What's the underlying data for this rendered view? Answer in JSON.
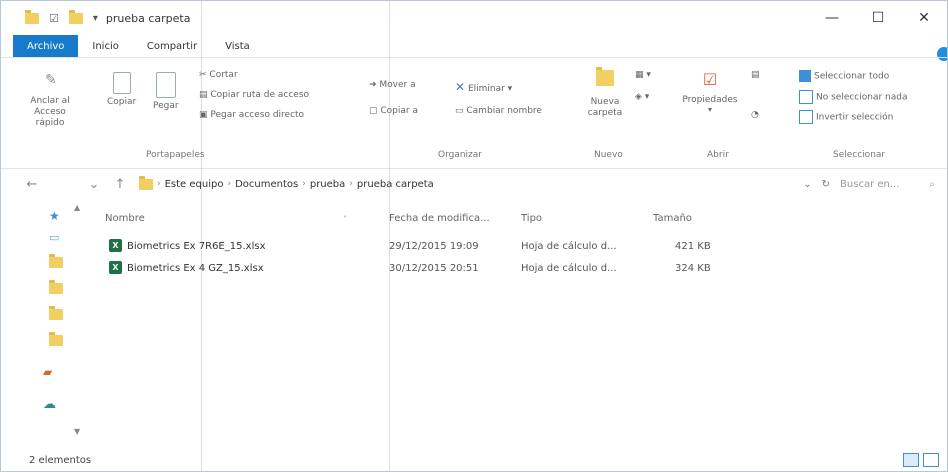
{
  "window": {
    "title": "prueba carpeta",
    "minimize": "—",
    "maximize": "☐",
    "close": "✕"
  },
  "tabs": [
    {
      "label": "Archivo",
      "active": true
    },
    {
      "label": "Inicio"
    },
    {
      "label": "Compartir"
    },
    {
      "label": "Vista"
    }
  ],
  "ribbon": {
    "pin_label": "Anclar al Acceso rápido",
    "copy_label": "Copiar",
    "paste_label": "Pegar",
    "cut_label": "Cortar",
    "copy_path_label": "Copiar ruta de acceso",
    "paste_shortcut_label": "Pegar acceso directo",
    "group_clipboard": "Portapapeles",
    "move_label": "Mover a",
    "copy_to_label": "Copiar a",
    "delete_label": "Eliminar",
    "rename_label": "Cambiar nombre",
    "group_organize": "Organizar",
    "new_folder_label": "Nueva carpeta",
    "group_new": "Nuevo",
    "properties_label": "Propiedades",
    "group_open": "Abrir",
    "select_all_label": "Seleccionar todo",
    "select_none_label": "No seleccionar nada",
    "invert_selection_label": "Invertir selección",
    "group_select": "Seleccionar"
  },
  "address": {
    "crumbs": [
      "Este equipo",
      "Documentos",
      "prueba",
      "prueba carpeta"
    ],
    "search_placeholder": "Buscar en..."
  },
  "columns": {
    "name": "Nombre",
    "date": "Fecha de modifica...",
    "type": "Tipo",
    "size": "Tamaño"
  },
  "files": [
    {
      "name": "Biometrics Ex 7R6E_15.xlsx",
      "date": "29/12/2015 19:09",
      "type": "Hoja de cálculo d...",
      "size": "421 KB"
    },
    {
      "name": "Biometrics Ex 4 GZ_15.xlsx",
      "date": "30/12/2015 20:51",
      "type": "Hoja de cálculo d...",
      "size": "324 KB"
    }
  ],
  "status": {
    "count": "2 elementos"
  },
  "colors": {
    "accent": "#1979ca",
    "excel": "#1e7145",
    "folder": "#f2cf62"
  }
}
